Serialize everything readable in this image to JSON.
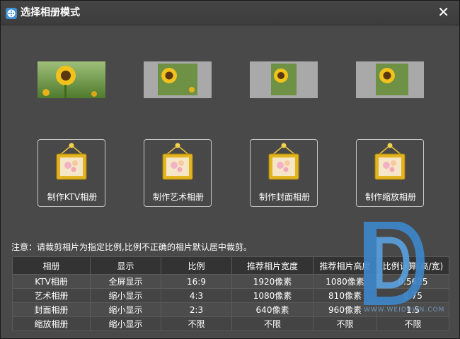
{
  "window": {
    "title": "选择相册模式",
    "close_label": "✕"
  },
  "modes": [
    {
      "label": "制作KTV相册"
    },
    {
      "label": "制作艺术相册"
    },
    {
      "label": "制作封面相册"
    },
    {
      "label": "制作缩放相册"
    }
  ],
  "notice": "注意：请裁剪相片为指定比例,比例不正确的相片默认居中裁剪。",
  "table": {
    "headers": [
      "相册",
      "显示",
      "比例",
      "推荐相片宽度",
      "推荐相片高度",
      "比例计算(高/宽)"
    ],
    "rows": [
      [
        "KTV相册",
        "全屏显示",
        "16:9",
        "1920像素",
        "1080像素",
        "0.5625"
      ],
      [
        "艺术相册",
        "缩小显示",
        "4:3",
        "1080像素",
        "810像素",
        "0.75"
      ],
      [
        "封面相册",
        "缩小显示",
        "2:3",
        "640像素",
        "960像素",
        "1.5"
      ],
      [
        "缩放相册",
        "缩小显示",
        "不限",
        "不限",
        "不限",
        "不限"
      ]
    ]
  },
  "watermark": {
    "text": "WWW.WEIDOWN.COM"
  },
  "colors": {
    "background": "#494949",
    "titlebar": "#3f3f3f",
    "frame_gold": "#e2b520",
    "header_bg": "#333333"
  }
}
